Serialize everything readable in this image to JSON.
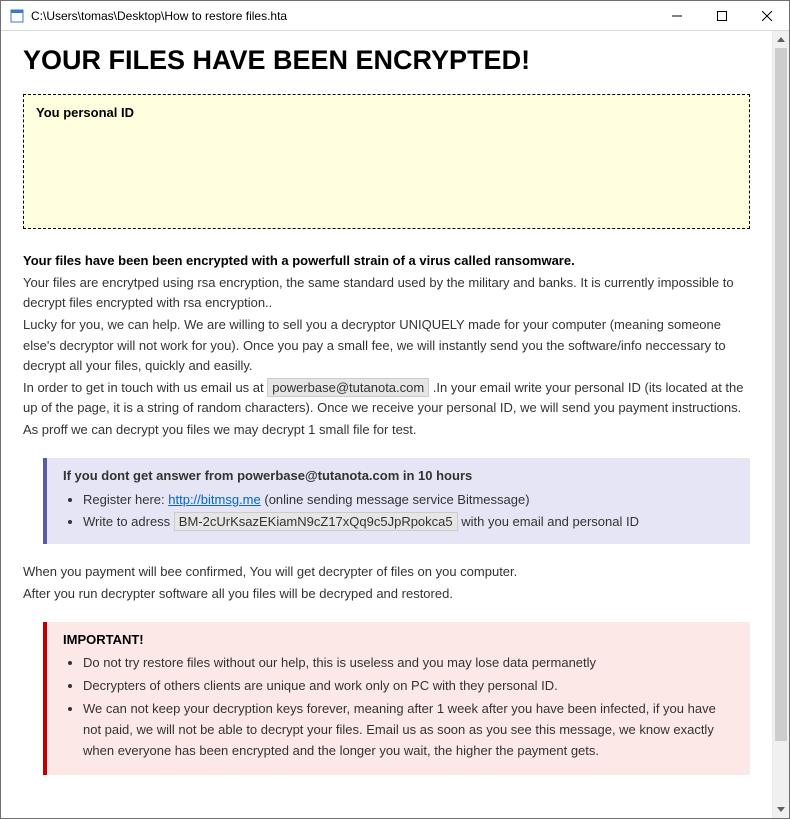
{
  "window": {
    "title": "C:\\Users\\tomas\\Desktop\\How to restore files.hta"
  },
  "headline": "YOUR FILES HAVE BEEN ENCRYPTED!",
  "id_box": {
    "label": "You personal ID"
  },
  "intro_bold": "Your files have been been encrypted with a powerfull strain of a virus called ransomware.",
  "para1": "Your files are encrytped using rsa encryption, the same standard used by the military and banks. It is currently impossible to decrypt files encrypted with rsa encryption..",
  "para2": "Lucky for you, we can help. We are willing to sell you a decryptor UNIQUELY made for your computer (meaning someone else's decryptor will not work for you). Once you pay a small fee, we will instantly send you the software/info neccessary to decrypt all your files, quickly and easilly.",
  "para3_a": "In order to get in touch with us email us at ",
  "email_primary": "powerbase@tutanota.com",
  "para3_b": " .In your email write your personal ID (its located at the up of the page, it is a string of random characters). Once we receive your personal ID, we will send you payment instructions.",
  "para4": "As proff we can decrypt you files we may decrypt 1 small file for test.",
  "secondary": {
    "head": "If you dont get answer from powerbase@tutanota.com in 10 hours",
    "item1_a": "Register here: ",
    "item1_link": "http://bitmsg.me",
    "item1_b": " (online sending message service Bitmessage)",
    "item2_a": "Write to adress ",
    "item2_addr": "BM-2cUrKsazEKiamN9cZ17xQq9c5JpRpokca5",
    "item2_b": " with you email and personal ID"
  },
  "after1": "When you payment will bee confirmed, You will get decrypter of files on you computer.",
  "after2": "After you run decrypter software all you files will be decryped and restored.",
  "important": {
    "head": "IMPORTANT!",
    "item1": "Do not try restore files without our help, this is useless and you may lose data permanetly",
    "item2": "Decrypters of others clients are unique and work only on PC with they personal ID.",
    "item3": "We can not keep your decryption keys forever, meaning after 1 week after you have been infected, if you have not paid, we will not be able to decrypt your files. Email us as soon as you see this message, we know exactly when everyone has been encrypted and the longer you wait, the higher the payment gets."
  }
}
